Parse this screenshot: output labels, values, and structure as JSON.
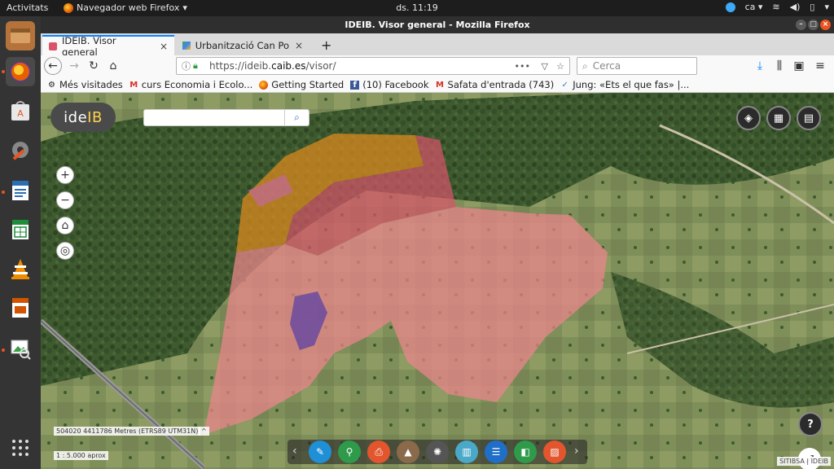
{
  "topbar": {
    "activities": "Activitats",
    "app_name": "Navegador web Firefox",
    "clock": "ds. 11:19",
    "lang": "ca"
  },
  "dock": {
    "items": [
      "files-icon",
      "firefox-icon",
      "software-store-icon",
      "settings-icon",
      "writer-icon",
      "calc-icon",
      "vlc-icon",
      "impress-icon",
      "image-viewer-icon",
      "apps-grid-icon"
    ]
  },
  "window": {
    "title": "IDEIB. Visor general - Mozilla Firefox"
  },
  "tabs": [
    {
      "label": "IDEIB. Visor general",
      "active": true
    },
    {
      "label": "Urbanització Can Porque",
      "active": false
    }
  ],
  "navbar": {
    "url_prefix": "https://ideib.",
    "url_domain": "caib.es",
    "url_path": "/visor/",
    "search_placeholder": "Cerca"
  },
  "bookmarks": [
    {
      "label": "Més visitades",
      "icon": "gear-icon"
    },
    {
      "label": "curs Economia i Ecolo...",
      "icon": "gmail-icon"
    },
    {
      "label": "Getting Started",
      "icon": "firefox-icon"
    },
    {
      "label": "(10) Facebook",
      "icon": "facebook-icon"
    },
    {
      "label": "Safata d'entrada (743)",
      "icon": "gmail-icon"
    },
    {
      "label": "Jung: «Ets el que fas» |...",
      "icon": "bookmark-icon"
    }
  ],
  "map": {
    "logo_ide": "ide",
    "logo_ib": "IB",
    "coords": "504020 4411786 Metres (ETRS89 UTM31N)",
    "scale": "1 : 5.000 aprox",
    "attribution": "SITIBSA | IDEIB",
    "overlay_colors": {
      "orange": "#d98a1f",
      "pink": "#e8868a",
      "purple": "#6b4aa0",
      "magenta": "#d9546b"
    }
  }
}
